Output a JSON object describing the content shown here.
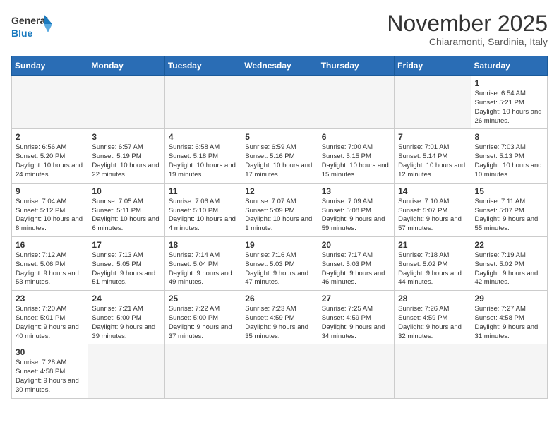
{
  "logo": {
    "line1": "General",
    "line2": "Blue"
  },
  "title": "November 2025",
  "subtitle": "Chiaramonti, Sardinia, Italy",
  "days_of_week": [
    "Sunday",
    "Monday",
    "Tuesday",
    "Wednesday",
    "Thursday",
    "Friday",
    "Saturday"
  ],
  "weeks": [
    [
      {
        "day": "",
        "info": ""
      },
      {
        "day": "",
        "info": ""
      },
      {
        "day": "",
        "info": ""
      },
      {
        "day": "",
        "info": ""
      },
      {
        "day": "",
        "info": ""
      },
      {
        "day": "",
        "info": ""
      },
      {
        "day": "1",
        "info": "Sunrise: 6:54 AM\nSunset: 5:21 PM\nDaylight: 10 hours and 26 minutes."
      }
    ],
    [
      {
        "day": "2",
        "info": "Sunrise: 6:56 AM\nSunset: 5:20 PM\nDaylight: 10 hours and 24 minutes."
      },
      {
        "day": "3",
        "info": "Sunrise: 6:57 AM\nSunset: 5:19 PM\nDaylight: 10 hours and 22 minutes."
      },
      {
        "day": "4",
        "info": "Sunrise: 6:58 AM\nSunset: 5:18 PM\nDaylight: 10 hours and 19 minutes."
      },
      {
        "day": "5",
        "info": "Sunrise: 6:59 AM\nSunset: 5:16 PM\nDaylight: 10 hours and 17 minutes."
      },
      {
        "day": "6",
        "info": "Sunrise: 7:00 AM\nSunset: 5:15 PM\nDaylight: 10 hours and 15 minutes."
      },
      {
        "day": "7",
        "info": "Sunrise: 7:01 AM\nSunset: 5:14 PM\nDaylight: 10 hours and 12 minutes."
      },
      {
        "day": "8",
        "info": "Sunrise: 7:03 AM\nSunset: 5:13 PM\nDaylight: 10 hours and 10 minutes."
      }
    ],
    [
      {
        "day": "9",
        "info": "Sunrise: 7:04 AM\nSunset: 5:12 PM\nDaylight: 10 hours and 8 minutes."
      },
      {
        "day": "10",
        "info": "Sunrise: 7:05 AM\nSunset: 5:11 PM\nDaylight: 10 hours and 6 minutes."
      },
      {
        "day": "11",
        "info": "Sunrise: 7:06 AM\nSunset: 5:10 PM\nDaylight: 10 hours and 4 minutes."
      },
      {
        "day": "12",
        "info": "Sunrise: 7:07 AM\nSunset: 5:09 PM\nDaylight: 10 hours and 1 minute."
      },
      {
        "day": "13",
        "info": "Sunrise: 7:09 AM\nSunset: 5:08 PM\nDaylight: 9 hours and 59 minutes."
      },
      {
        "day": "14",
        "info": "Sunrise: 7:10 AM\nSunset: 5:07 PM\nDaylight: 9 hours and 57 minutes."
      },
      {
        "day": "15",
        "info": "Sunrise: 7:11 AM\nSunset: 5:07 PM\nDaylight: 9 hours and 55 minutes."
      }
    ],
    [
      {
        "day": "16",
        "info": "Sunrise: 7:12 AM\nSunset: 5:06 PM\nDaylight: 9 hours and 53 minutes."
      },
      {
        "day": "17",
        "info": "Sunrise: 7:13 AM\nSunset: 5:05 PM\nDaylight: 9 hours and 51 minutes."
      },
      {
        "day": "18",
        "info": "Sunrise: 7:14 AM\nSunset: 5:04 PM\nDaylight: 9 hours and 49 minutes."
      },
      {
        "day": "19",
        "info": "Sunrise: 7:16 AM\nSunset: 5:03 PM\nDaylight: 9 hours and 47 minutes."
      },
      {
        "day": "20",
        "info": "Sunrise: 7:17 AM\nSunset: 5:03 PM\nDaylight: 9 hours and 46 minutes."
      },
      {
        "day": "21",
        "info": "Sunrise: 7:18 AM\nSunset: 5:02 PM\nDaylight: 9 hours and 44 minutes."
      },
      {
        "day": "22",
        "info": "Sunrise: 7:19 AM\nSunset: 5:02 PM\nDaylight: 9 hours and 42 minutes."
      }
    ],
    [
      {
        "day": "23",
        "info": "Sunrise: 7:20 AM\nSunset: 5:01 PM\nDaylight: 9 hours and 40 minutes."
      },
      {
        "day": "24",
        "info": "Sunrise: 7:21 AM\nSunset: 5:00 PM\nDaylight: 9 hours and 39 minutes."
      },
      {
        "day": "25",
        "info": "Sunrise: 7:22 AM\nSunset: 5:00 PM\nDaylight: 9 hours and 37 minutes."
      },
      {
        "day": "26",
        "info": "Sunrise: 7:23 AM\nSunset: 4:59 PM\nDaylight: 9 hours and 35 minutes."
      },
      {
        "day": "27",
        "info": "Sunrise: 7:25 AM\nSunset: 4:59 PM\nDaylight: 9 hours and 34 minutes."
      },
      {
        "day": "28",
        "info": "Sunrise: 7:26 AM\nSunset: 4:59 PM\nDaylight: 9 hours and 32 minutes."
      },
      {
        "day": "29",
        "info": "Sunrise: 7:27 AM\nSunset: 4:58 PM\nDaylight: 9 hours and 31 minutes."
      }
    ],
    [
      {
        "day": "30",
        "info": "Sunrise: 7:28 AM\nSunset: 4:58 PM\nDaylight: 9 hours and 30 minutes."
      },
      {
        "day": "",
        "info": ""
      },
      {
        "day": "",
        "info": ""
      },
      {
        "day": "",
        "info": ""
      },
      {
        "day": "",
        "info": ""
      },
      {
        "day": "",
        "info": ""
      },
      {
        "day": "",
        "info": ""
      }
    ]
  ],
  "colors": {
    "header_bg": "#2a6db5",
    "header_text": "#ffffff",
    "empty_cell": "#f5f5f5"
  }
}
